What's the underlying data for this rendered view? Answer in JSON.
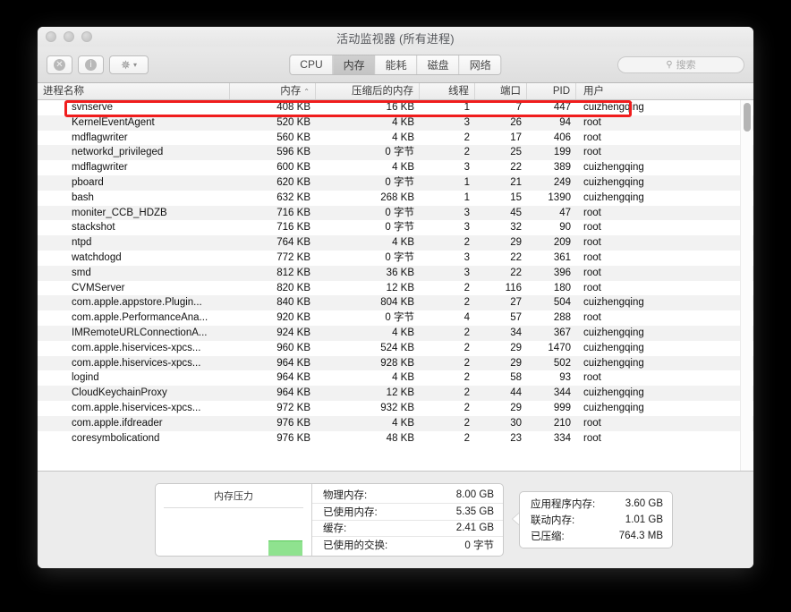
{
  "window": {
    "title": "活动监视器 (所有进程)",
    "traffic_lights": [
      "close",
      "minimize",
      "zoom"
    ]
  },
  "toolbar": {
    "quit_process_label": "⊗",
    "inspect_label": "ⓘ",
    "gear_label": "✳",
    "gear_chevron": "⌄",
    "tabs": [
      {
        "label": "CPU",
        "active": false
      },
      {
        "label": "内存",
        "active": true
      },
      {
        "label": "能耗",
        "active": false
      },
      {
        "label": "磁盘",
        "active": false
      },
      {
        "label": "网络",
        "active": false
      }
    ],
    "search": {
      "icon": "🔍",
      "placeholder": "搜索",
      "value": ""
    }
  },
  "table": {
    "columns": [
      {
        "key": "name",
        "label": "进程名称",
        "sorted": false
      },
      {
        "key": "memory",
        "label": "内存",
        "sorted": true,
        "sort_arrow": "⌃"
      },
      {
        "key": "compressed",
        "label": "压缩后的内存",
        "sorted": false
      },
      {
        "key": "threads",
        "label": "线程",
        "sorted": false
      },
      {
        "key": "ports",
        "label": "端口",
        "sorted": false
      },
      {
        "key": "pid",
        "label": "PID",
        "sorted": false
      },
      {
        "key": "user",
        "label": "用户",
        "sorted": false
      }
    ],
    "rows": [
      {
        "name": "svnserve",
        "memory": "408 KB",
        "compressed": "16 KB",
        "threads": "1",
        "ports": "7",
        "pid": "447",
        "user": "cuizhengqing",
        "highlighted": true
      },
      {
        "name": "KernelEventAgent",
        "memory": "520 KB",
        "compressed": "4 KB",
        "threads": "3",
        "ports": "26",
        "pid": "94",
        "user": "root"
      },
      {
        "name": "mdflagwriter",
        "memory": "560 KB",
        "compressed": "4 KB",
        "threads": "2",
        "ports": "17",
        "pid": "406",
        "user": "root"
      },
      {
        "name": "networkd_privileged",
        "memory": "596 KB",
        "compressed": "0 字节",
        "threads": "2",
        "ports": "25",
        "pid": "199",
        "user": "root"
      },
      {
        "name": "mdflagwriter",
        "memory": "600 KB",
        "compressed": "4 KB",
        "threads": "3",
        "ports": "22",
        "pid": "389",
        "user": "cuizhengqing"
      },
      {
        "name": "pboard",
        "memory": "620 KB",
        "compressed": "0 字节",
        "threads": "1",
        "ports": "21",
        "pid": "249",
        "user": "cuizhengqing"
      },
      {
        "name": "bash",
        "memory": "632 KB",
        "compressed": "268 KB",
        "threads": "1",
        "ports": "15",
        "pid": "1390",
        "user": "cuizhengqing"
      },
      {
        "name": "moniter_CCB_HDZB",
        "memory": "716 KB",
        "compressed": "0 字节",
        "threads": "3",
        "ports": "45",
        "pid": "47",
        "user": "root"
      },
      {
        "name": "stackshot",
        "memory": "716 KB",
        "compressed": "0 字节",
        "threads": "3",
        "ports": "32",
        "pid": "90",
        "user": "root"
      },
      {
        "name": "ntpd",
        "memory": "764 KB",
        "compressed": "4 KB",
        "threads": "2",
        "ports": "29",
        "pid": "209",
        "user": "root"
      },
      {
        "name": "watchdogd",
        "memory": "772 KB",
        "compressed": "0 字节",
        "threads": "3",
        "ports": "22",
        "pid": "361",
        "user": "root"
      },
      {
        "name": "smd",
        "memory": "812 KB",
        "compressed": "36 KB",
        "threads": "3",
        "ports": "22",
        "pid": "396",
        "user": "root"
      },
      {
        "name": "CVMServer",
        "memory": "820 KB",
        "compressed": "12 KB",
        "threads": "2",
        "ports": "116",
        "pid": "180",
        "user": "root"
      },
      {
        "name": "com.apple.appstore.Plugin...",
        "memory": "840 KB",
        "compressed": "804 KB",
        "threads": "2",
        "ports": "27",
        "pid": "504",
        "user": "cuizhengqing"
      },
      {
        "name": "com.apple.PerformanceAna...",
        "memory": "920 KB",
        "compressed": "0 字节",
        "threads": "4",
        "ports": "57",
        "pid": "288",
        "user": "root"
      },
      {
        "name": "IMRemoteURLConnectionA...",
        "memory": "924 KB",
        "compressed": "4 KB",
        "threads": "2",
        "ports": "34",
        "pid": "367",
        "user": "cuizhengqing"
      },
      {
        "name": "com.apple.hiservices-xpcs...",
        "memory": "960 KB",
        "compressed": "524 KB",
        "threads": "2",
        "ports": "29",
        "pid": "1470",
        "user": "cuizhengqing"
      },
      {
        "name": "com.apple.hiservices-xpcs...",
        "memory": "964 KB",
        "compressed": "928 KB",
        "threads": "2",
        "ports": "29",
        "pid": "502",
        "user": "cuizhengqing"
      },
      {
        "name": "logind",
        "memory": "964 KB",
        "compressed": "4 KB",
        "threads": "2",
        "ports": "58",
        "pid": "93",
        "user": "root"
      },
      {
        "name": "CloudKeychainProxy",
        "memory": "964 KB",
        "compressed": "12 KB",
        "threads": "2",
        "ports": "44",
        "pid": "344",
        "user": "cuizhengqing"
      },
      {
        "name": "com.apple.hiservices-xpcs...",
        "memory": "972 KB",
        "compressed": "932 KB",
        "threads": "2",
        "ports": "29",
        "pid": "999",
        "user": "cuizhengqing"
      },
      {
        "name": "com.apple.ifdreader",
        "memory": "976 KB",
        "compressed": "4 KB",
        "threads": "2",
        "ports": "30",
        "pid": "210",
        "user": "root"
      },
      {
        "name": "coresymbolicationd",
        "memory": "976 KB",
        "compressed": "48 KB",
        "threads": "2",
        "ports": "23",
        "pid": "334",
        "user": "root"
      }
    ]
  },
  "annotation": {
    "color": "#f01d1d",
    "target_row": "svnserve"
  },
  "footer": {
    "pressure": {
      "title": "内存压力",
      "bar_color": "#8fe28f"
    },
    "left_stats": [
      {
        "label": "物理内存:",
        "value": "8.00 GB"
      },
      {
        "label": "已使用内存:",
        "value": "5.35 GB"
      },
      {
        "label": "缓存:",
        "value": "2.41 GB"
      },
      {
        "label": "已使用的交换:",
        "value": "0 字节"
      }
    ],
    "right_stats": [
      {
        "label": "应用程序内存:",
        "value": "3.60 GB"
      },
      {
        "label": "联动内存:",
        "value": "1.01 GB"
      },
      {
        "label": "已压缩:",
        "value": "764.3 MB"
      }
    ]
  }
}
